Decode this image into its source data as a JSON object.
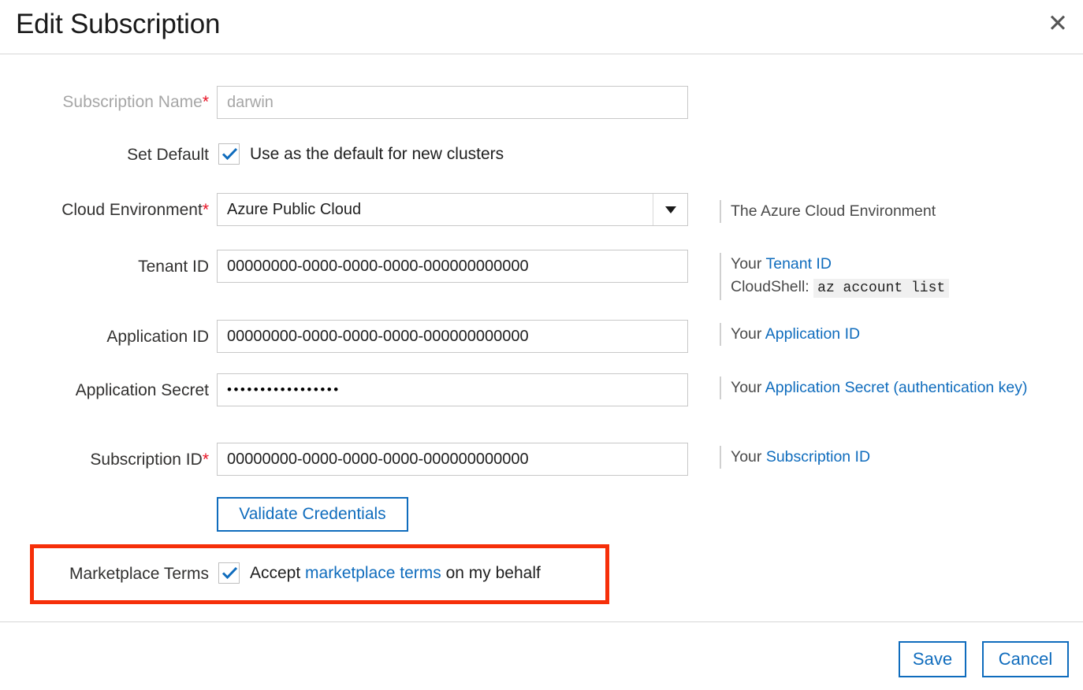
{
  "header": {
    "title": "Edit Subscription",
    "help_icon": "question-mark-icon",
    "help_glyph": "?",
    "close_icon": "close-icon",
    "close_glyph": "✕"
  },
  "form": {
    "subscription_name": {
      "label": "Subscription Name",
      "required_marker": "*",
      "value": "darwin",
      "placeholder": "darwin",
      "disabled": true
    },
    "set_default": {
      "label": "Set Default",
      "checkbox_label": "Use as the default for new clusters",
      "checked": true
    },
    "cloud_environment": {
      "label": "Cloud Environment",
      "required_marker": "*",
      "value": "Azure Public Cloud",
      "options": [
        "Azure Public Cloud"
      ],
      "help_text": "The Azure Cloud Environment"
    },
    "tenant_id": {
      "label": "Tenant ID",
      "value": "00000000-0000-0000-0000-000000000000",
      "help_prefix": "Your ",
      "help_link": "Tenant ID",
      "help_line2_prefix": "CloudShell: ",
      "help_code": "az account list"
    },
    "application_id": {
      "label": "Application ID",
      "value": "00000000-0000-0000-0000-000000000000",
      "help_prefix": "Your ",
      "help_link": "Application ID"
    },
    "application_secret": {
      "label": "Application Secret",
      "value": "•••••••••••••••••",
      "help_prefix": "Your ",
      "help_link": "Application Secret (authentication key)"
    },
    "subscription_id": {
      "label": "Subscription ID",
      "required_marker": "*",
      "value": "00000000-0000-0000-0000-000000000000",
      "help_prefix": "Your ",
      "help_link": "Subscription ID"
    },
    "validate_button": {
      "label": "Validate Credentials"
    },
    "marketplace_terms": {
      "label": "Marketplace Terms",
      "checked": true,
      "text_before": "Accept ",
      "link_text": "marketplace terms",
      "text_after": " on my behalf",
      "highlight_color": "#f62f09"
    }
  },
  "footer": {
    "save_label": "Save",
    "cancel_label": "Cancel"
  },
  "colors": {
    "accent": "#0f6cbd",
    "required": "#e81123",
    "highlight": "#f62f09",
    "border": "#c8c8c8"
  }
}
